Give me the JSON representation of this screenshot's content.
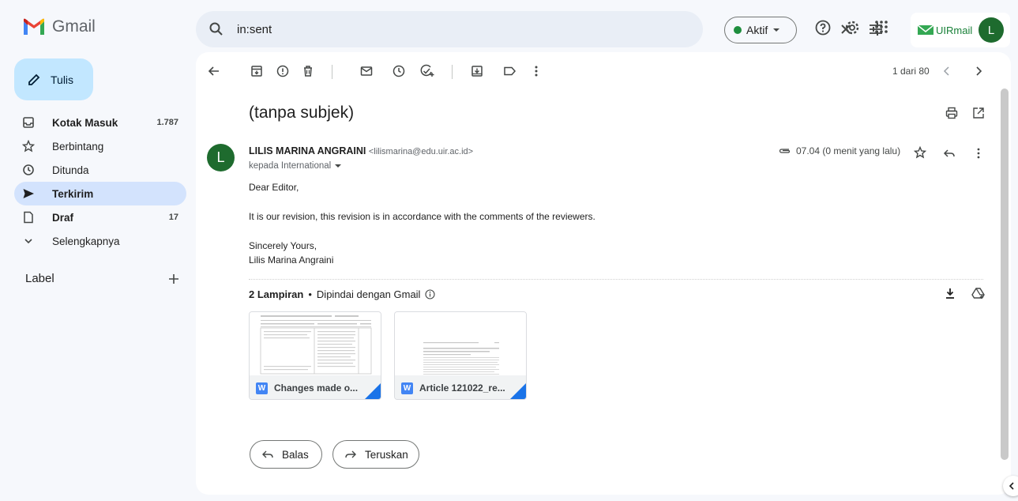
{
  "app": {
    "brand": "Gmail"
  },
  "search": {
    "query": "in:sent"
  },
  "status": {
    "label": "Aktif",
    "color": "#1e8e3e"
  },
  "account": {
    "brand": "UIRmail",
    "avatar_letter": "L"
  },
  "sidebar": {
    "compose_label": "Tulis",
    "items": [
      {
        "label": "Kotak Masuk",
        "count": "1.787",
        "icon": "inbox-icon"
      },
      {
        "label": "Berbintang",
        "count": "",
        "icon": "star-icon"
      },
      {
        "label": "Ditunda",
        "count": "",
        "icon": "clock-icon"
      },
      {
        "label": "Terkirim",
        "count": "",
        "icon": "send-icon"
      },
      {
        "label": "Draf",
        "count": "17",
        "icon": "draft-icon"
      },
      {
        "label": "Selengkapnya",
        "count": "",
        "icon": "chevron-down-icon"
      }
    ],
    "label_heading": "Label"
  },
  "toolbar": {
    "pager": "1 dari 80"
  },
  "message": {
    "subject": "(tanpa subjek)",
    "sender_name": "LILIS MARINA ANGRAINI",
    "sender_email": "<lilismarina@edu.uir.ac.id>",
    "avatar_letter": "L",
    "to": "kepada International",
    "time": "07.04 (0 menit yang lalu)",
    "body": {
      "greeting": "Dear Editor,",
      "paragraph": "It is our revision, this revision is in accordance with the comments of the reviewers.",
      "closing": "Sincerely Yours,",
      "signature": "Lilis Marina Angraini"
    }
  },
  "attachments": {
    "count_label": "2 Lampiran",
    "scan_label": "Dipindai dengan Gmail",
    "files": [
      {
        "name": "Changes made o...",
        "type_badge": "W"
      },
      {
        "name": "Article 121022_re...",
        "type_badge": "W"
      }
    ]
  },
  "actions": {
    "reply_label": "Balas",
    "forward_label": "Teruskan"
  },
  "colors": {
    "accent": "#c2e7ff",
    "active_nav": "#d3e3fd",
    "avatar": "#1e6b2e",
    "word_blue": "#4285f4"
  }
}
